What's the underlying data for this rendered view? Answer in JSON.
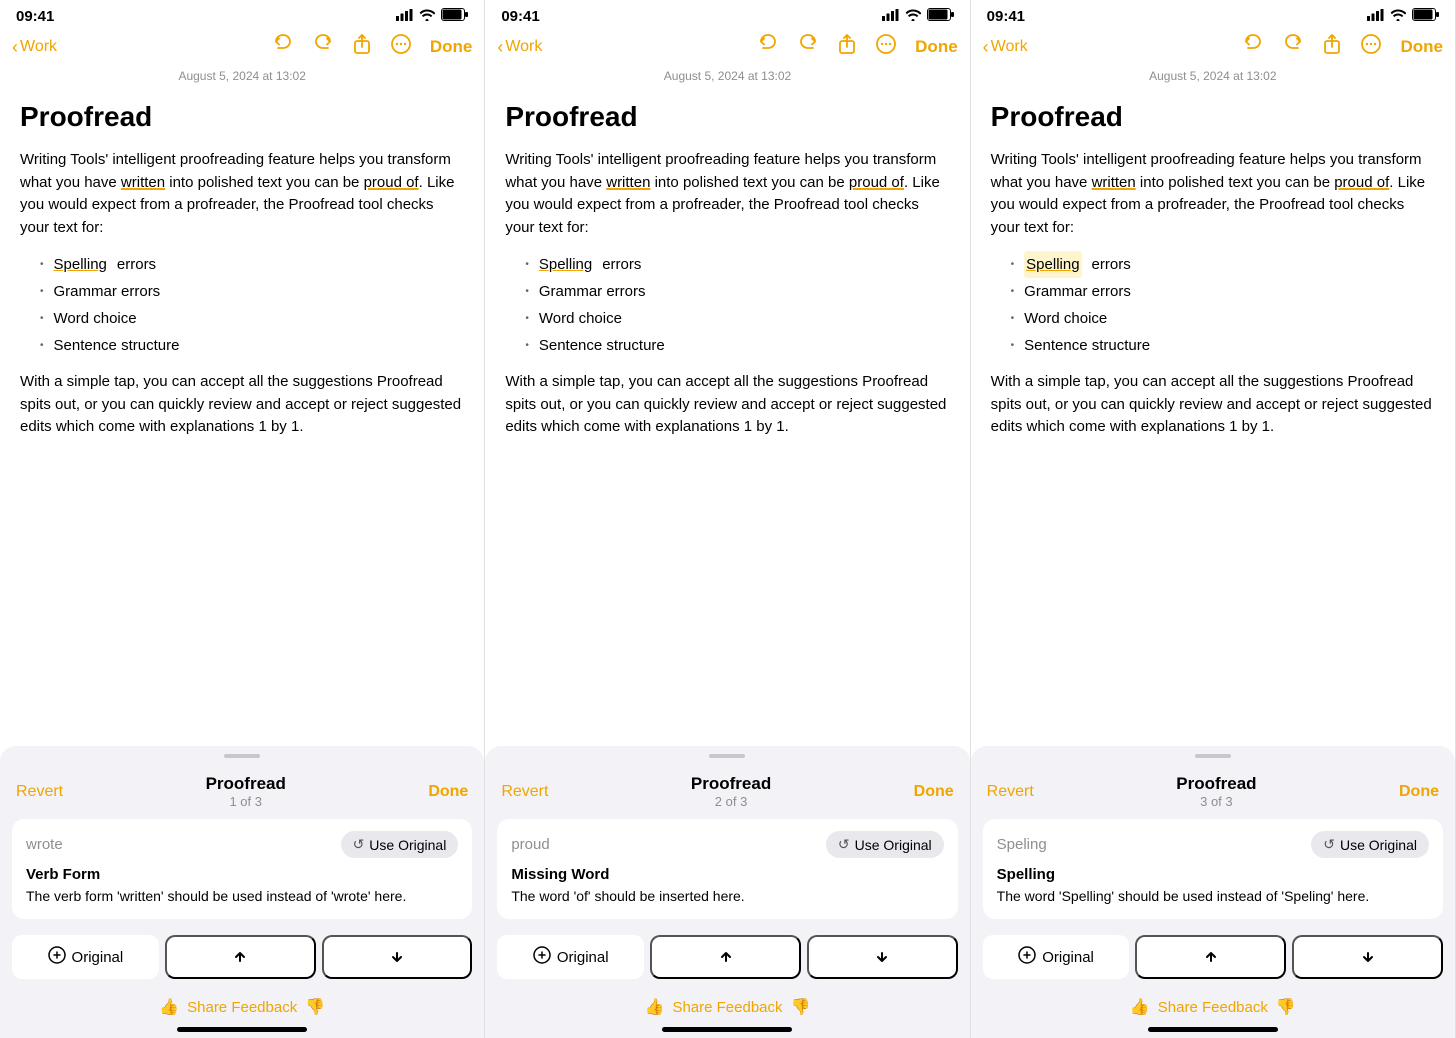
{
  "panels": [
    {
      "id": "panel1",
      "status": {
        "time": "09:41",
        "signal": "▋▋▋",
        "wifi": "WiFi",
        "battery": 85
      },
      "nav": {
        "back_label": "Work",
        "done_label": "Done"
      },
      "timestamp": "August 5, 2024 at 13:02",
      "note": {
        "title": "Proofread",
        "body_intro": "Writing Tools' intelligent proofreading feature helps you transform what you have ",
        "body_written": "written",
        "body_mid": " into polished text you can be ",
        "body_proud": "proud of",
        "body_rest": ". Like you would expect from a proofreader, the Proofread tool checks your text for:",
        "bullets": [
          "Spelling errors",
          "Grammar errors",
          "Word choice",
          "Sentence structure"
        ],
        "body_end": "With a simple tap, you can accept all the suggestions Proofread spits out, or you can quickly review and accept or reject suggested edits which come with explanations 1 by 1."
      },
      "sheet": {
        "revert": "Revert",
        "title": "Proofread",
        "subtitle": "1 of 3",
        "done": "Done"
      },
      "suggestion": {
        "word": "wrote",
        "use_original": "Use Original",
        "type": "Verb Form",
        "description": "The verb form 'written' should be used instead of 'wrote' here."
      },
      "bottom_bar": {
        "original": "Original",
        "up": "↑",
        "down": "↓"
      },
      "feedback": {
        "label": "Share Feedback"
      }
    },
    {
      "id": "panel2",
      "status": {
        "time": "09:41",
        "signal": "▋▋▋",
        "wifi": "WiFi",
        "battery": 85
      },
      "nav": {
        "back_label": "Work",
        "done_label": "Done"
      },
      "timestamp": "August 5, 2024 at 13:02",
      "note": {
        "title": "Proofread",
        "body_intro": "Writing Tools' intelligent proofreading feature helps you transform what you have ",
        "body_written": "written",
        "body_mid": " into polished text you can be ",
        "body_proud": "proud of",
        "body_rest": ". Like you would expect from a proofreader, the Proofread tool checks your text for:",
        "bullets": [
          "Spelling errors",
          "Grammar errors",
          "Word choice",
          "Sentence structure"
        ],
        "body_end": "With a simple tap, you can accept all the suggestions Proofread spits out, or you can quickly review and accept or reject suggested edits which come with explanations 1 by 1."
      },
      "sheet": {
        "revert": "Revert",
        "title": "Proofread",
        "subtitle": "2 of 3",
        "done": "Done"
      },
      "suggestion": {
        "word": "proud",
        "use_original": "Use Original",
        "type": "Missing Word",
        "description": "The word 'of' should be inserted here."
      },
      "bottom_bar": {
        "original": "Original",
        "up": "↑",
        "down": "↓"
      },
      "feedback": {
        "label": "Share Feedback"
      }
    },
    {
      "id": "panel3",
      "status": {
        "time": "09:41",
        "signal": "▋▋▋",
        "wifi": "WiFi",
        "battery": 85
      },
      "nav": {
        "back_label": "Work",
        "done_label": "Done"
      },
      "timestamp": "August 5, 2024 at 13:02",
      "note": {
        "title": "Proofread",
        "body_intro": "Writing Tools' intelligent proofreading feature helps you transform what you have ",
        "body_written": "written",
        "body_mid": " into polished text you can be ",
        "body_proud": "proud of",
        "body_rest": ". Like you would expect from a proofreader, the Proofread tool checks your text for:",
        "bullets": [
          "Spelling errors",
          "Grammar errors",
          "Word choice",
          "Sentence structure"
        ],
        "body_end": "With a simple tap, you can accept all the suggestions Proofread spits out, or you can quickly review and accept or reject suggested edits which come with explanations 1 by 1."
      },
      "sheet": {
        "revert": "Revert",
        "title": "Proofread",
        "subtitle": "3 of 3",
        "done": "Done"
      },
      "suggestion": {
        "word": "Speling",
        "use_original": "Use Original",
        "type": "Spelling",
        "description": "The word 'Spelling' should be used instead of 'Speling' here."
      },
      "bottom_bar": {
        "original": "Original",
        "up": "↑",
        "down": "↓"
      },
      "feedback": {
        "label": "Share Feedback"
      }
    }
  ]
}
